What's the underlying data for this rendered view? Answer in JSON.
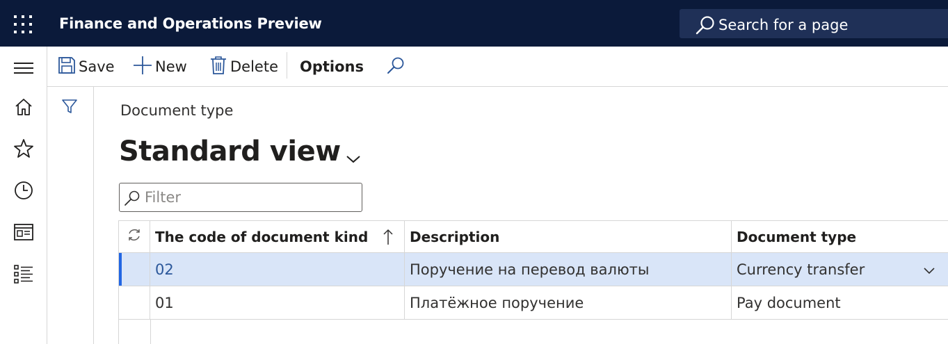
{
  "app": {
    "title": "Finance and Operations Preview"
  },
  "search": {
    "label": "Search for a page"
  },
  "toolbar": {
    "save_label": "Save",
    "new_label": "New",
    "delete_label": "Delete",
    "options_label": "Options"
  },
  "page": {
    "caption": "Document type",
    "view_name": "Standard view",
    "filter_placeholder": "Filter"
  },
  "grid": {
    "columns": [
      "The code of document kind",
      "Description",
      "Document type"
    ],
    "rows": [
      {
        "code": "02",
        "description": "Поручение на перевод валюты",
        "type": "Currency transfer",
        "selected": true
      },
      {
        "code": "01",
        "description": "Платёжное поручение",
        "type": "Pay document",
        "selected": false
      }
    ]
  },
  "colors": {
    "topbar": "#0b1a3a",
    "search_bg": "#1f3057",
    "accent": "#2266e3",
    "selected_row": "#d9e5f8",
    "icon_blue": "#2b579a"
  },
  "icons": {
    "waffle": "app-launcher-icon",
    "search": "search-icon",
    "menu": "hamburger-icon",
    "home": "home-icon",
    "favorites": "star-icon",
    "recent": "clock-icon",
    "workspaces": "workspace-icon",
    "modules": "list-icon",
    "save": "save-icon",
    "new": "plus-icon",
    "delete": "trash-icon",
    "find": "search-icon",
    "filter_pane": "funnel-icon",
    "refresh": "refresh-icon",
    "sort": "sort-ascending-icon",
    "dropdown": "chevron-down-icon"
  }
}
